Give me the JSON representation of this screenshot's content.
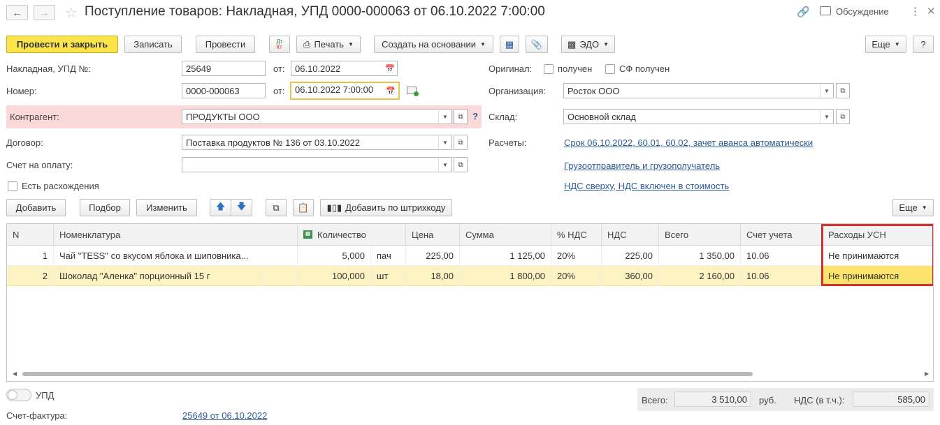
{
  "header": {
    "title": "Поступление товаров: Накладная, УПД 0000-000063 от 06.10.2022 7:00:00",
    "discussion_label": "Обсуждение"
  },
  "toolbar": {
    "post_close": "Провести и закрыть",
    "save": "Записать",
    "post": "Провести",
    "print": "Печать",
    "create_based": "Создать на основании",
    "edo": "ЭДО",
    "more": "Еще",
    "help": "?"
  },
  "form": {
    "invoice_label": "Накладная, УПД №:",
    "invoice_number": "25649",
    "from_label": "от:",
    "invoice_date": "06.10.2022",
    "number_label": "Номер:",
    "number_value": "0000-000063",
    "number_date": "06.10.2022  7:00:00",
    "contractor_label": "Контрагент:",
    "contractor_value": "ПРОДУКТЫ ООО",
    "contract_label": "Договор:",
    "contract_value": "Поставка продуктов № 136 от 03.10.2022",
    "payment_label": "Счет на оплату:",
    "payment_value": "",
    "discrepancy_label": "Есть расхождения",
    "original_label": "Оригинал:",
    "received_label": "получен",
    "sf_received_label": "СФ получен",
    "org_label": "Организация:",
    "org_value": "Росток ООО",
    "warehouse_label": "Склад:",
    "warehouse_value": "Основной склад",
    "settlements_label": "Расчеты:",
    "settlements_link": "Срок 06.10.2022, 60.01, 60.02, зачет аванса автоматически",
    "shipper_link": "Грузоотправитель и грузополучатель",
    "vat_link": "НДС сверху, НДС включен в стоимость"
  },
  "table_toolbar": {
    "add": "Добавить",
    "pick": "Подбор",
    "change": "Изменить",
    "barcode": "Добавить по штрихкоду",
    "more": "Еще"
  },
  "table": {
    "headers": [
      "N",
      "Номенклатура",
      "Количество",
      "Цена",
      "Сумма",
      "% НДС",
      "НДС",
      "Всего",
      "Счет учета",
      "Расходы УСН"
    ],
    "rows": [
      {
        "n": "1",
        "name": "Чай \"TESS\" со вкусом яблока и шиповника...",
        "qty": "5,000",
        "unit": "пач",
        "price": "225,00",
        "sum": "1 125,00",
        "vat_rate": "20%",
        "vat": "225,00",
        "total": "1 350,00",
        "account": "10.06",
        "usn": "Не принимаются"
      },
      {
        "n": "2",
        "name": "Шоколад \"Аленка\" порционный 15 г",
        "qty": "100,000",
        "unit": "шт",
        "price": "18,00",
        "sum": "1 800,00",
        "vat_rate": "20%",
        "vat": "360,00",
        "total": "2 160,00",
        "account": "10.06",
        "usn": "Не принимаются"
      }
    ]
  },
  "footer": {
    "upd_label": "УПД",
    "invoice_label": "Счет-фактура:",
    "invoice_link": "25649 от 06.10.2022",
    "total_label": "Всего:",
    "total_value": "3 510,00",
    "currency": "руб.",
    "vat_label": "НДС (в т.ч.):",
    "vat_value": "585,00"
  },
  "colors": {
    "primary_button": "#fbe54b",
    "error_row": "#fbd9d9",
    "selected_row": "#fdf3c2",
    "highlight_border": "#d32f2f",
    "link": "#2b5b9a"
  }
}
